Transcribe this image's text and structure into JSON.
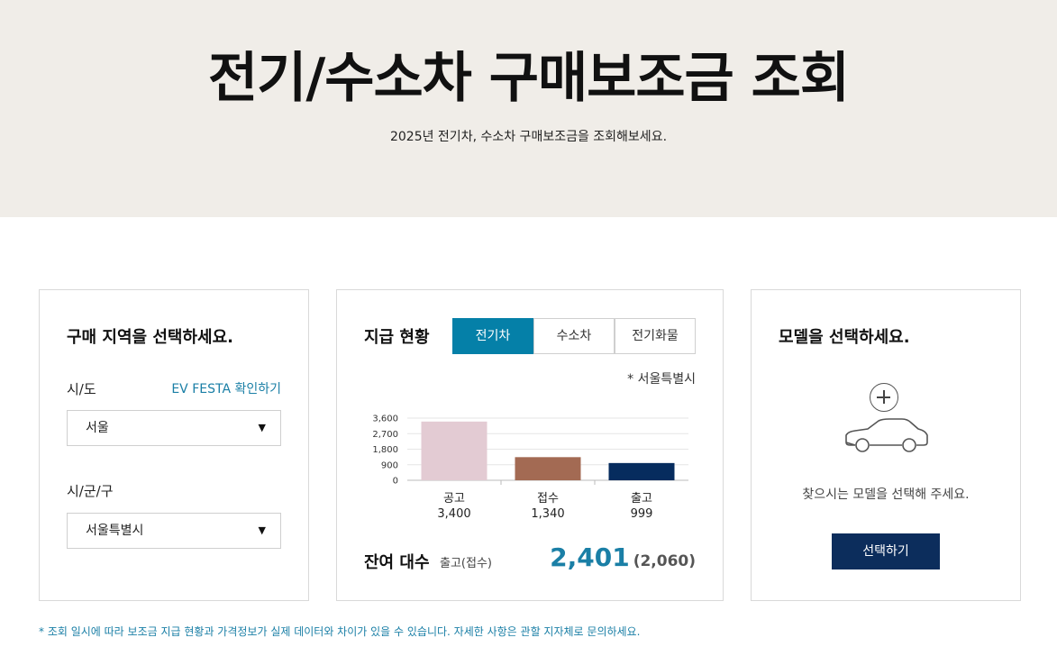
{
  "hero": {
    "title": "전기/수소차 구매보조금 조회",
    "subtitle": "2025년 전기차, 수소차 구매보조금을 조회해보세요."
  },
  "region_card": {
    "title": "구매 지역을 선택하세요.",
    "sido_label": "시/도",
    "festa_link": "EV FESTA 확인하기",
    "sido_value": "서울",
    "sigungu_label": "시/군/구",
    "sigungu_value": "서울특별시"
  },
  "status_card": {
    "title": "지급 현황",
    "tabs": [
      {
        "label": "전기차",
        "active": true
      },
      {
        "label": "수소차",
        "active": false
      },
      {
        "label": "전기화물",
        "active": false
      }
    ],
    "region_note": "* 서울특별시",
    "remaining_label": "잔여 대수",
    "remaining_sub": "출고(접수)",
    "remaining_value": "2,401",
    "remaining_paren": "(2,060)"
  },
  "chart_data": {
    "type": "bar",
    "categories": [
      "공고",
      "접수",
      "출고"
    ],
    "values": [
      3400,
      1340,
      999
    ],
    "value_labels": [
      "3,400",
      "1,340",
      "999"
    ],
    "yticks": [
      0,
      900,
      1800,
      2700,
      3600
    ],
    "ytick_labels": [
      "0",
      "900",
      "1,800",
      "2,700",
      "3,600"
    ],
    "ylim": [
      0,
      3600
    ],
    "grid": true,
    "colors": [
      "#e3cbd3",
      "#a36a53",
      "#062c5e"
    ]
  },
  "model_card": {
    "title": "모델을 선택하세요.",
    "hint": "찾으시는 모델을 선택해 주세요.",
    "button": "선택하기",
    "icons": [
      "plus-circle-icon",
      "car-icon"
    ]
  },
  "disclaimer": "* 조회 일시에 따라 보조금 지급 현황과 가격정보가 실제 데이터와 차이가 있을 수 있습니다. 자세한 사항은 관할 지자체로 문의하세요."
}
